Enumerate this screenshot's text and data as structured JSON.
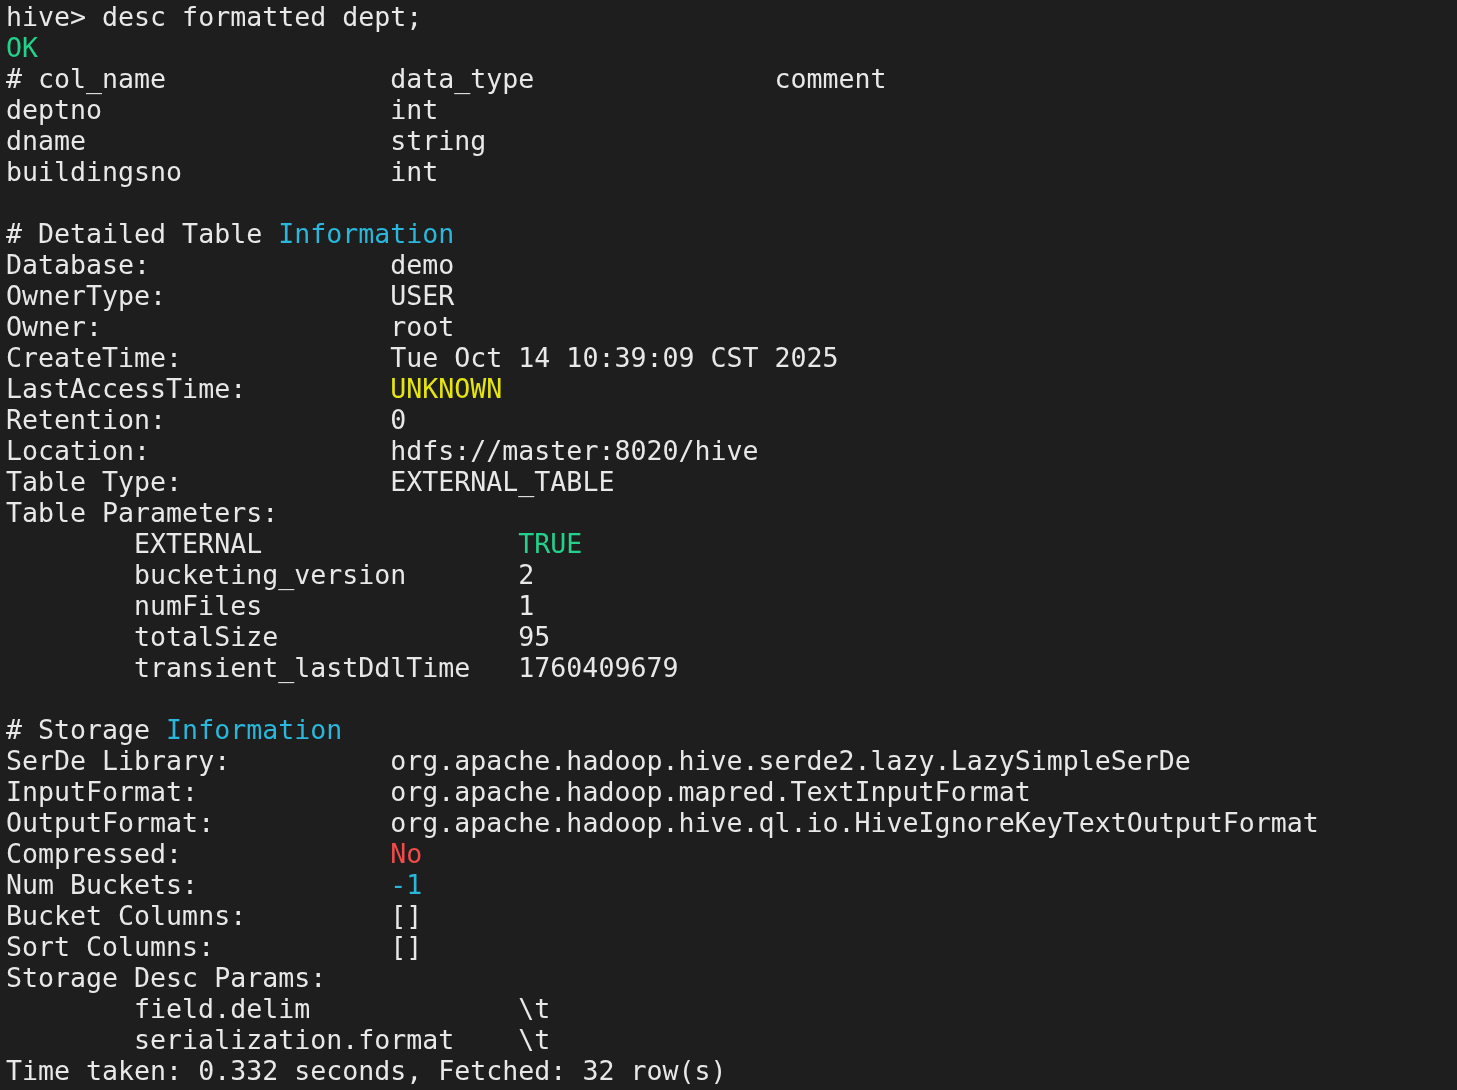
{
  "terminal": {
    "lines": [
      {
        "kind": "text",
        "segments": [
          {
            "text": "hive> desc formatted dept;"
          }
        ]
      },
      {
        "kind": "text",
        "segments": [
          {
            "text": "OK",
            "color": "#23d18b"
          }
        ]
      },
      {
        "kind": "row",
        "cells": [
          {
            "text": "# col_name"
          },
          {
            "text": "data_type"
          },
          {
            "text": "comment"
          }
        ]
      },
      {
        "kind": "row",
        "cells": [
          {
            "text": "deptno"
          },
          {
            "text": "int"
          }
        ]
      },
      {
        "kind": "row",
        "cells": [
          {
            "text": "dname"
          },
          {
            "text": "string"
          }
        ]
      },
      {
        "kind": "row",
        "cells": [
          {
            "text": "buildingsno"
          },
          {
            "text": "int"
          }
        ]
      },
      {
        "kind": "blank"
      },
      {
        "kind": "text",
        "segments": [
          {
            "text": "# Detailed Table "
          },
          {
            "text": "Information",
            "color": "#29b8db"
          }
        ]
      },
      {
        "kind": "row",
        "cells": [
          {
            "text": "Database:"
          },
          {
            "text": "demo"
          }
        ]
      },
      {
        "kind": "row",
        "cells": [
          {
            "text": "OwnerType:"
          },
          {
            "text": "USER"
          }
        ]
      },
      {
        "kind": "row",
        "cells": [
          {
            "text": "Owner:"
          },
          {
            "text": "root"
          }
        ]
      },
      {
        "kind": "row",
        "cells": [
          {
            "text": "CreateTime:"
          },
          {
            "text": "Tue Oct 14 10:39:09 CST 2025"
          }
        ]
      },
      {
        "kind": "row",
        "cells": [
          {
            "text": "LastAccessTime:"
          },
          {
            "text": "UNKNOWN",
            "color": "#e5e510"
          }
        ]
      },
      {
        "kind": "row",
        "cells": [
          {
            "text": "Retention:"
          },
          {
            "text": "0"
          }
        ]
      },
      {
        "kind": "row",
        "cells": [
          {
            "text": "Location:"
          },
          {
            "text": "hdfs://master:8020/hive"
          }
        ]
      },
      {
        "kind": "row",
        "cells": [
          {
            "text": "Table Type:"
          },
          {
            "text": "EXTERNAL_TABLE"
          }
        ]
      },
      {
        "kind": "row",
        "cells": [
          {
            "text": "Table Parameters:"
          }
        ]
      },
      {
        "kind": "param",
        "cells": [
          {
            "text": "EXTERNAL"
          },
          {
            "text": "TRUE",
            "color": "#23d18b"
          }
        ]
      },
      {
        "kind": "param",
        "cells": [
          {
            "text": "bucketing_version"
          },
          {
            "text": "2"
          }
        ]
      },
      {
        "kind": "param",
        "cells": [
          {
            "text": "numFiles"
          },
          {
            "text": "1"
          }
        ]
      },
      {
        "kind": "param",
        "cells": [
          {
            "text": "totalSize"
          },
          {
            "text": "95"
          }
        ]
      },
      {
        "kind": "param",
        "cells": [
          {
            "text": "transient_lastDdlTime"
          },
          {
            "text": "1760409679"
          }
        ]
      },
      {
        "kind": "blank"
      },
      {
        "kind": "text",
        "segments": [
          {
            "text": "# Storage "
          },
          {
            "text": "Information",
            "color": "#29b8db"
          }
        ]
      },
      {
        "kind": "row",
        "cells": [
          {
            "text": "SerDe Library:"
          },
          {
            "text": "org.apache.hadoop.hive.serde2.lazy.LazySimpleSerDe"
          }
        ]
      },
      {
        "kind": "row",
        "cells": [
          {
            "text": "InputFormat:"
          },
          {
            "text": "org.apache.hadoop.mapred.TextInputFormat"
          }
        ]
      },
      {
        "kind": "row",
        "cells": [
          {
            "text": "OutputFormat:"
          },
          {
            "text": "org.apache.hadoop.hive.ql.io.HiveIgnoreKeyTextOutputFormat"
          }
        ]
      },
      {
        "kind": "row",
        "cells": [
          {
            "text": "Compressed:"
          },
          {
            "text": "No",
            "color": "#f14c4c"
          }
        ]
      },
      {
        "kind": "row",
        "cells": [
          {
            "text": "Num Buckets:"
          },
          {
            "text": "-1",
            "color": "#29b8db"
          }
        ]
      },
      {
        "kind": "row",
        "cells": [
          {
            "text": "Bucket Columns:"
          },
          {
            "text": "[]"
          }
        ]
      },
      {
        "kind": "row",
        "cells": [
          {
            "text": "Sort Columns:"
          },
          {
            "text": "[]"
          }
        ]
      },
      {
        "kind": "row",
        "cells": [
          {
            "text": "Storage Desc Params:"
          }
        ]
      },
      {
        "kind": "param",
        "cells": [
          {
            "text": "field.delim"
          },
          {
            "text": "\\t"
          }
        ]
      },
      {
        "kind": "param",
        "cells": [
          {
            "text": "serialization.format"
          },
          {
            "text": "\\t"
          }
        ]
      },
      {
        "kind": "text",
        "segments": [
          {
            "text": "Time taken: 0.332 seconds, Fetched: 32 row(s)"
          }
        ]
      }
    ]
  }
}
